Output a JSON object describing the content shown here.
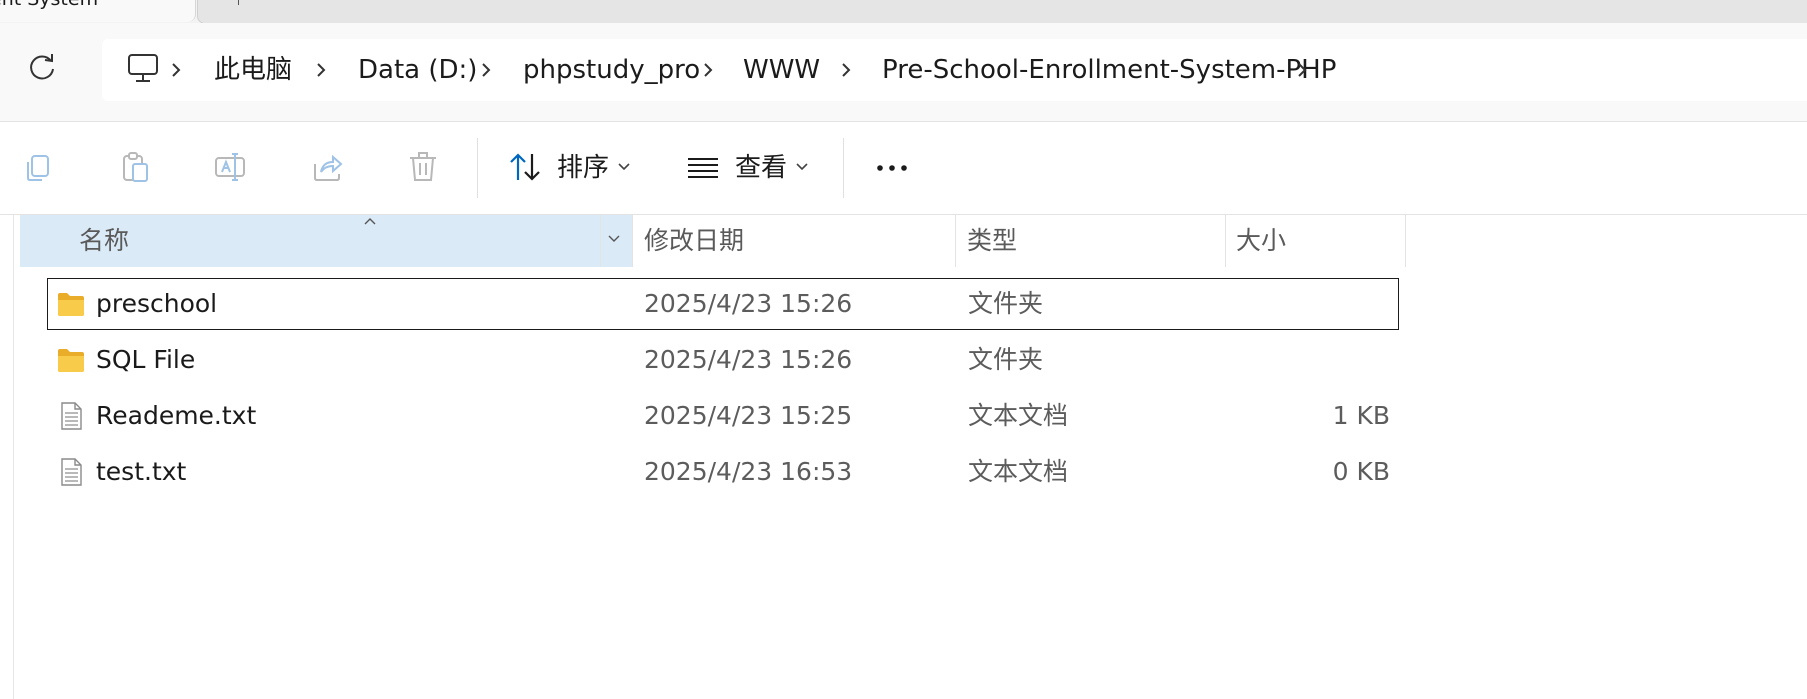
{
  "tab": {
    "active_title": "ent System"
  },
  "address": {
    "breadcrumbs": [
      "此电脑",
      "Data (D:)",
      "phpstudy_pro",
      "WWW",
      "Pre-School-Enrollment-System-PHP"
    ]
  },
  "toolbar": {
    "sort_label": "排序",
    "view_label": "查看",
    "more_label": "···"
  },
  "columns": {
    "name": "名称",
    "modified": "修改日期",
    "type": "类型",
    "size": "大小"
  },
  "files": [
    {
      "name": "preschool",
      "modified": "2025/4/23 15:26",
      "type": "文件夹",
      "size": "",
      "icon": "folder-icon",
      "selected": true
    },
    {
      "name": "SQL File",
      "modified": "2025/4/23 15:26",
      "type": "文件夹",
      "size": "",
      "icon": "folder-icon",
      "selected": false
    },
    {
      "name": "Reademe.txt",
      "modified": "2025/4/23 15:25",
      "type": "文本文档",
      "size": "1 KB",
      "icon": "text-file-icon",
      "selected": false
    },
    {
      "name": "test.txt",
      "modified": "2025/4/23 16:53",
      "type": "文本文档",
      "size": "0 KB",
      "icon": "text-file-icon",
      "selected": false
    }
  ],
  "colors": {
    "header_highlight": "#dbeaf7",
    "accent": "#0067c0",
    "folder": "#f6c544"
  }
}
